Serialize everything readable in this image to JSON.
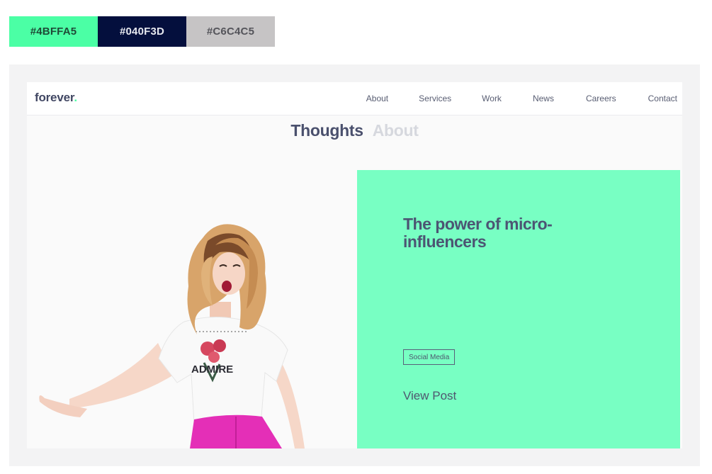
{
  "swatches": [
    {
      "label": "#4BFFA5",
      "color": "#4BFFA5"
    },
    {
      "label": "#040F3D",
      "color": "#040F3D"
    },
    {
      "label": "#C6C4C5",
      "color": "#C6C4C5"
    }
  ],
  "logo": {
    "text": "forever",
    "dot": "."
  },
  "nav": {
    "items": [
      {
        "label": "About"
      },
      {
        "label": "Services"
      },
      {
        "label": "Work"
      },
      {
        "label": "News"
      },
      {
        "label": "Careers"
      },
      {
        "label": "Contact"
      }
    ]
  },
  "section_tabs": [
    {
      "label": "Thoughts",
      "active": true
    },
    {
      "label": "About",
      "active": false
    }
  ],
  "hero_image": {
    "shirt_text": "ADMIRE",
    "icon": "woman-photo"
  },
  "post": {
    "title": "The power of micro-influencers",
    "tag": "Social Media",
    "link": "View Post",
    "background": "#78FFC3"
  }
}
